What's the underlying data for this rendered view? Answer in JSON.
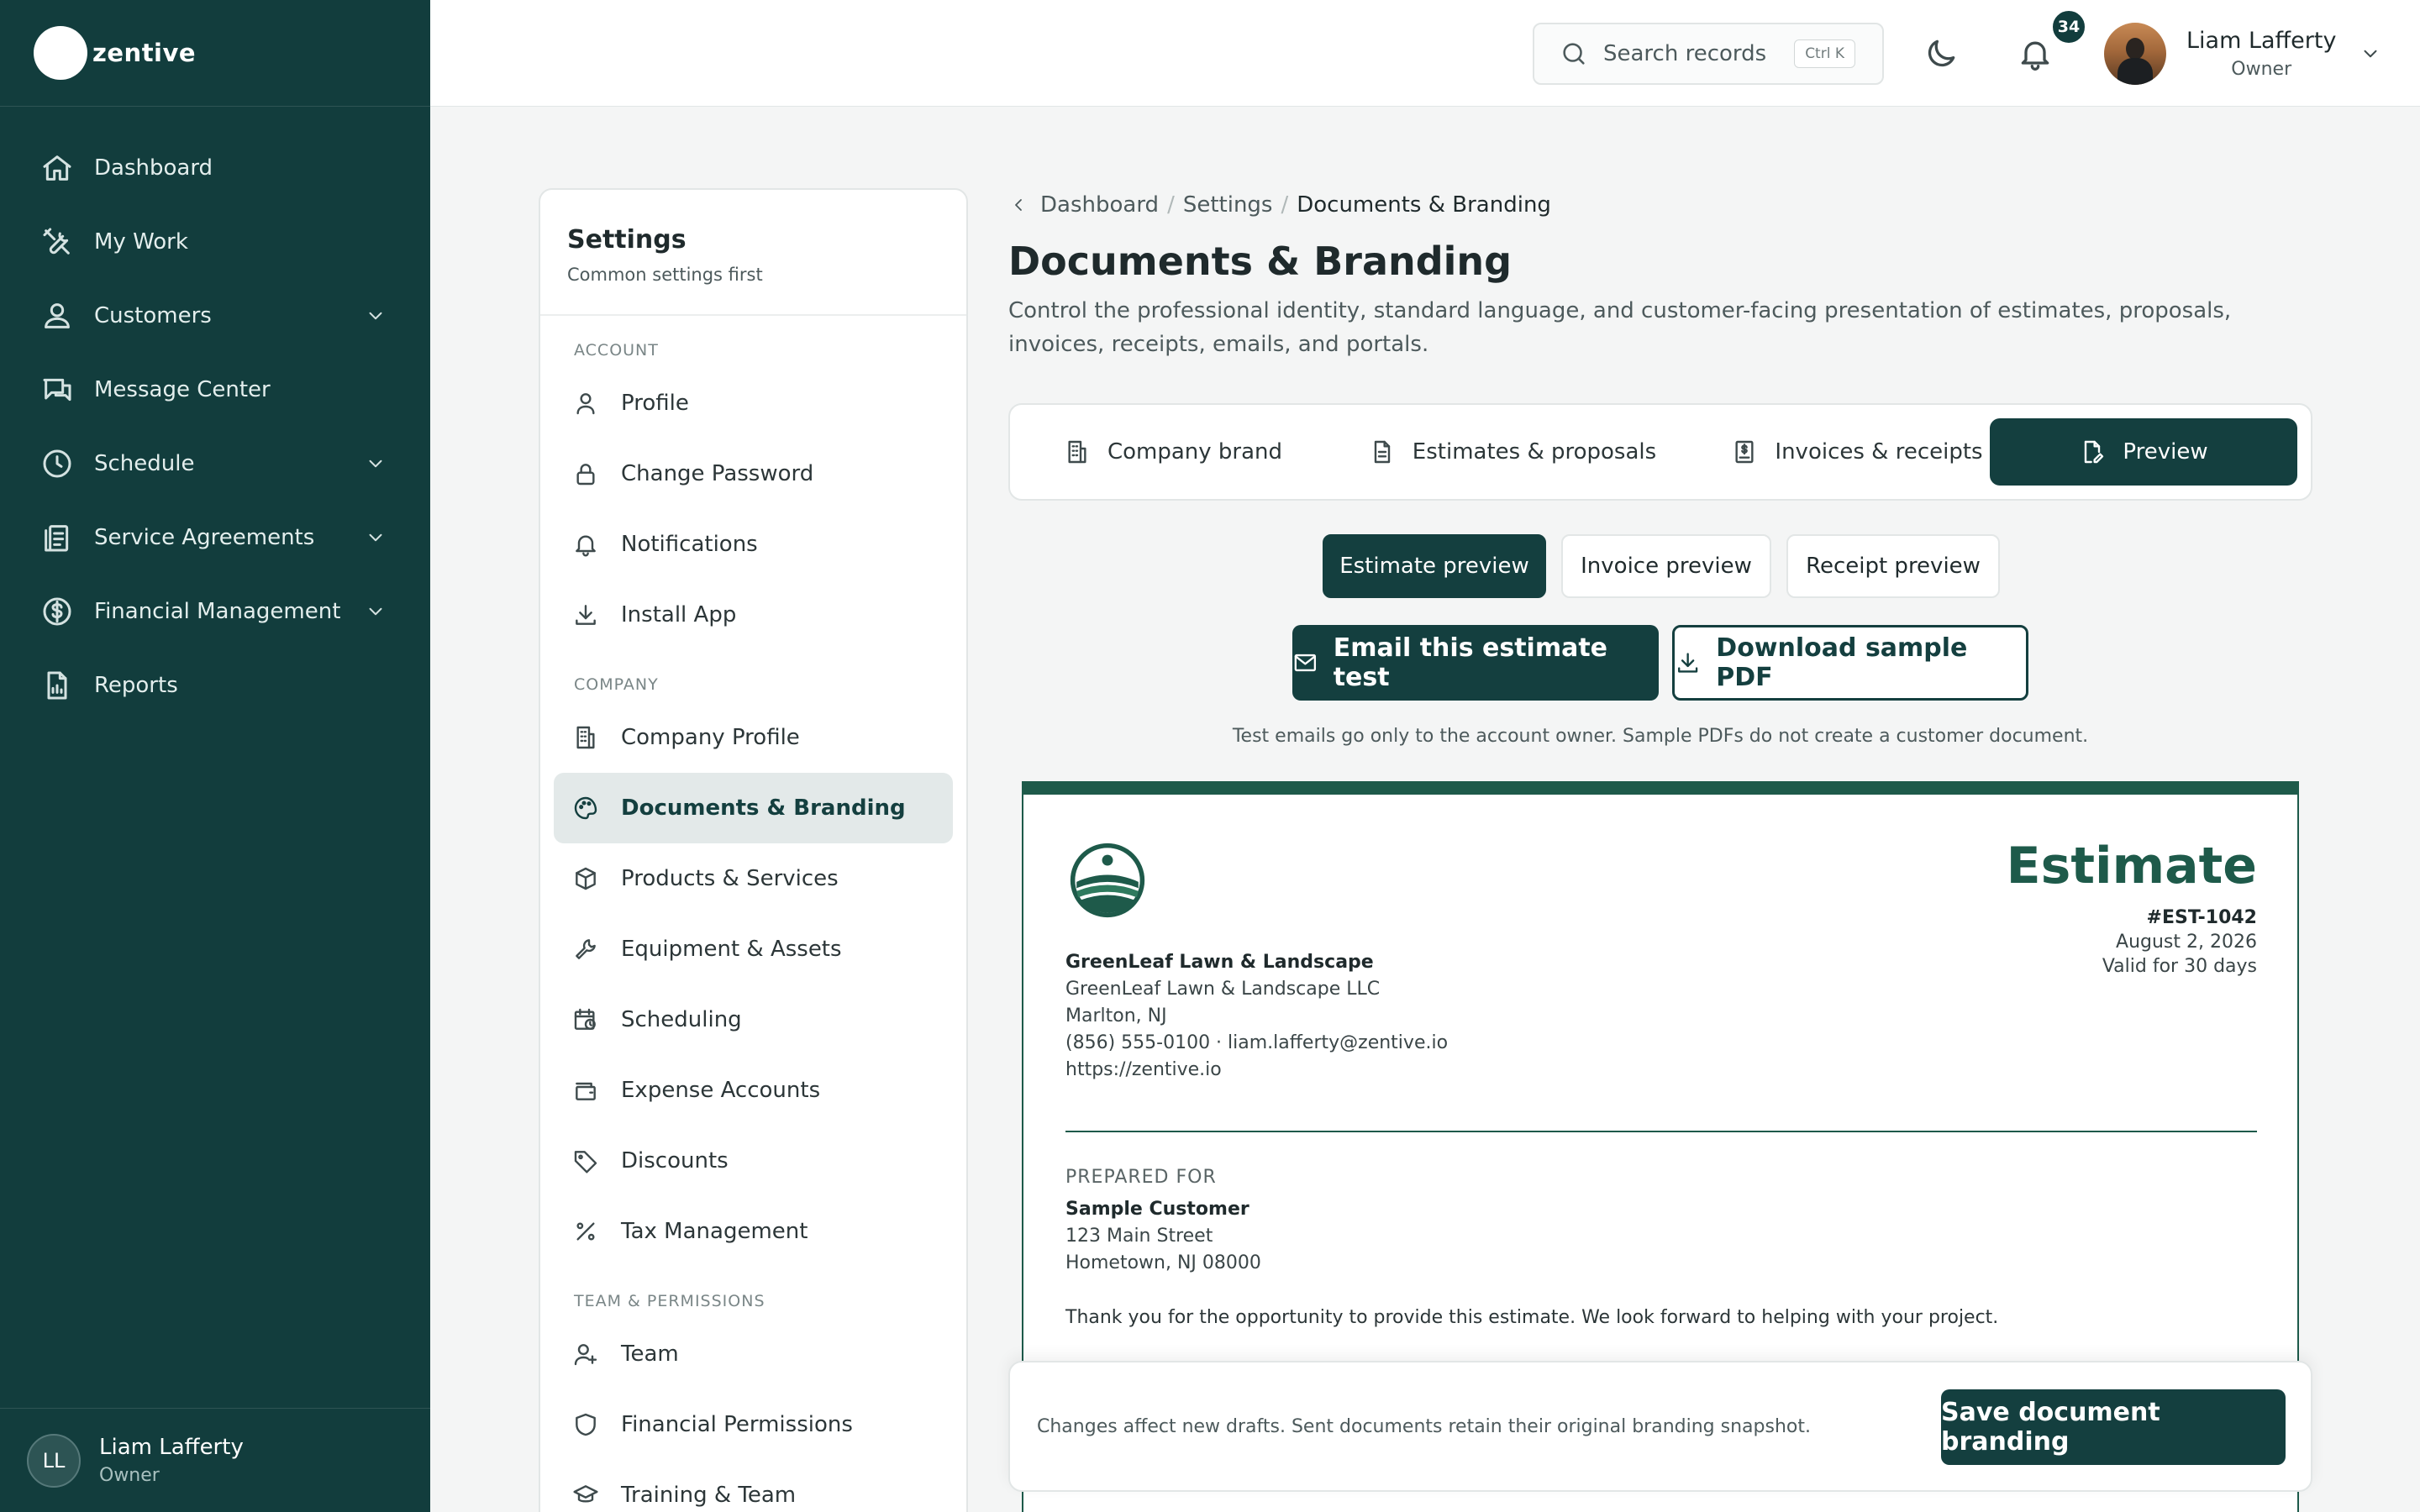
{
  "brand": {
    "name": "zentive"
  },
  "sidebar": {
    "items": [
      {
        "label": "Dashboard",
        "icon": "home-icon",
        "expandable": false
      },
      {
        "label": "My Work",
        "icon": "tools-icon",
        "expandable": false
      },
      {
        "label": "Customers",
        "icon": "users-icon",
        "expandable": true
      },
      {
        "label": "Message Center",
        "icon": "chat-icon",
        "expandable": false
      },
      {
        "label": "Schedule",
        "icon": "clock-icon",
        "expandable": true
      },
      {
        "label": "Service Agreements",
        "icon": "clipboard-icon",
        "expandable": true
      },
      {
        "label": "Financial Management",
        "icon": "dollar-icon",
        "expandable": true
      },
      {
        "label": "Reports",
        "icon": "report-icon",
        "expandable": false
      }
    ],
    "footer": {
      "initials": "LL",
      "name": "Liam Lafferty",
      "role": "Owner"
    }
  },
  "topbar": {
    "search_placeholder": "Search records",
    "search_shortcut": "Ctrl K",
    "notification_count": "34",
    "user": {
      "name": "Liam Lafferty",
      "role": "Owner"
    }
  },
  "settings": {
    "title": "Settings",
    "subtitle": "Common settings first",
    "sections": {
      "account": "ACCOUNT",
      "company": "COMPANY",
      "team": "TEAM & PERMISSIONS"
    },
    "account_items": [
      "Profile",
      "Change Password",
      "Notifications",
      "Install App"
    ],
    "company_items": [
      "Company Profile",
      "Documents & Branding",
      "Products & Services",
      "Equipment & Assets",
      "Scheduling",
      "Expense Accounts",
      "Discounts",
      "Tax Management"
    ],
    "team_items": [
      "Team",
      "Financial Permissions",
      "Training & Team"
    ],
    "active_item": "Documents & Branding"
  },
  "main": {
    "breadcrumb": [
      "Dashboard",
      "Settings",
      "Documents & Branding"
    ],
    "title": "Documents & Branding",
    "description": "Control the professional identity, standard language, and customer-facing presentation of estimates, proposals, invoices, receipts, emails, and portals.",
    "tabs": [
      "Company brand",
      "Estimates & proposals",
      "Invoices & receipts",
      "Preview"
    ],
    "active_tab": "Preview",
    "preview_tabs": [
      "Estimate preview",
      "Invoice preview",
      "Receipt preview"
    ],
    "active_preview": "Estimate preview",
    "actions": {
      "email_test": "Email this estimate test",
      "download_pdf": "Download sample PDF"
    },
    "note": "Test emails go only to the account owner. Sample PDFs do not create a customer document."
  },
  "document": {
    "business_name": "GreenLeaf Lawn & Landscape",
    "legal_name": "GreenLeaf Lawn & Landscape LLC",
    "location": "Marlton, NJ",
    "contact": "(856) 555-0100 · liam.lafferty@zentive.io",
    "website": "https://zentive.io",
    "doc_type": "Estimate",
    "doc_number": "#EST-1042",
    "date": "August 2, 2026",
    "validity": "Valid for 30 days",
    "prepared_for_label": "PREPARED FOR",
    "customer_name": "Sample Customer",
    "customer_street": "123 Main Street",
    "customer_city": "Hometown, NJ 08000",
    "thanks": "Thank you for the opportunity to provide this estimate. We look forward to helping with your project."
  },
  "savebar": {
    "message": "Changes affect new drafts. Sent documents retain their original branding snapshot.",
    "save_label": "Save document branding"
  },
  "colors": {
    "brand_dark": "#123d3d",
    "accent": "#1e5a4a",
    "background": "#f4f5f5"
  }
}
